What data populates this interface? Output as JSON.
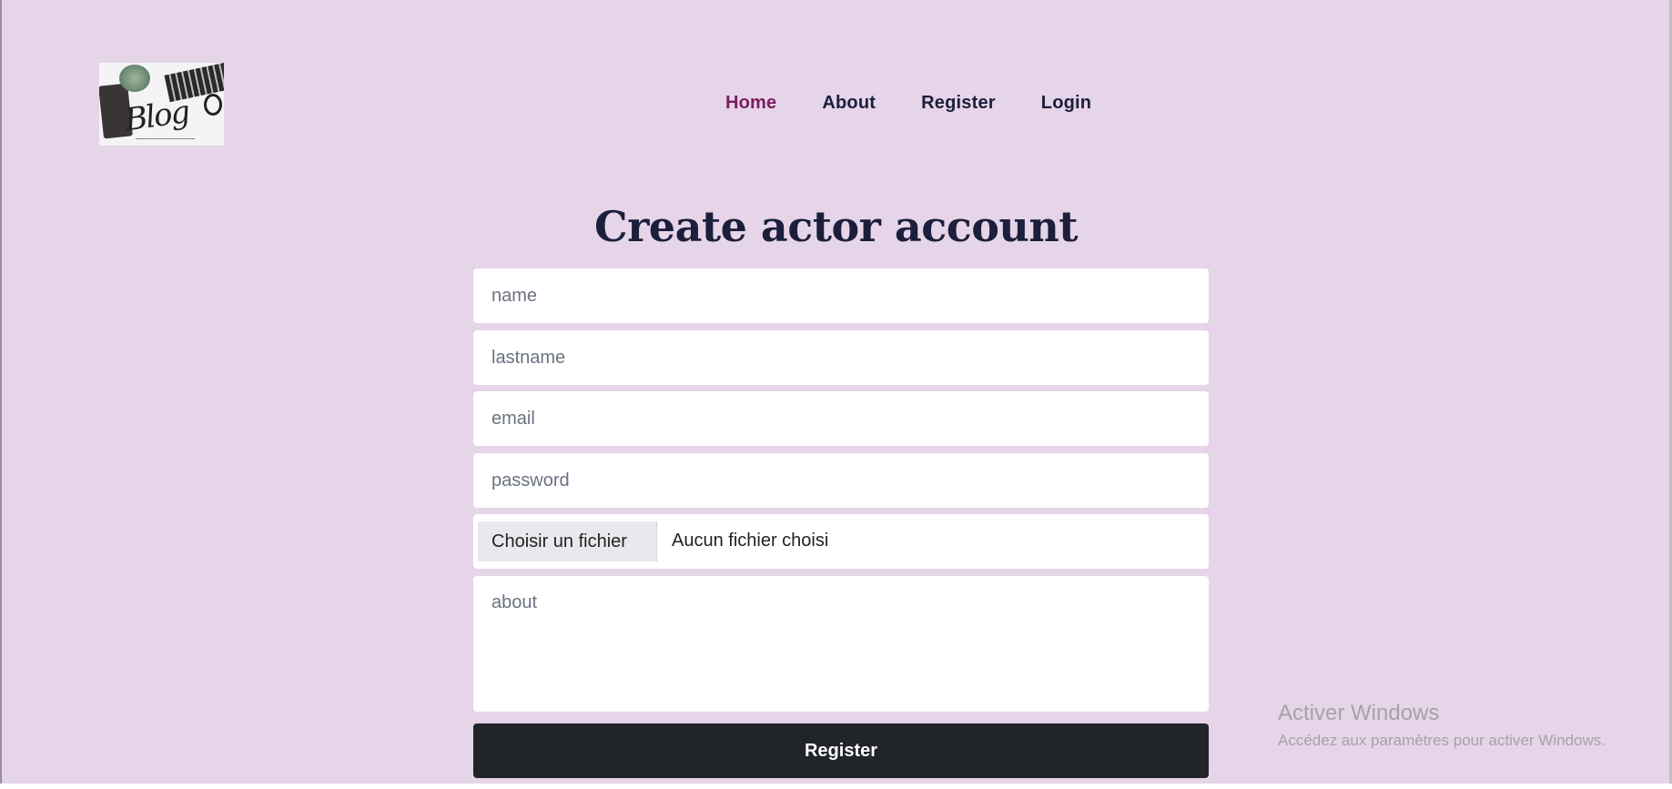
{
  "header": {
    "logo_text": "Blog",
    "nav": [
      {
        "label": "Home",
        "active": true
      },
      {
        "label": "About",
        "active": false
      },
      {
        "label": "Register",
        "active": false
      },
      {
        "label": "Login",
        "active": false
      }
    ]
  },
  "form": {
    "title": "Create actor account",
    "fields": {
      "name_placeholder": "name",
      "lastname_placeholder": "lastname",
      "email_placeholder": "email",
      "password_placeholder": "password",
      "about_placeholder": "about"
    },
    "file": {
      "button_label": "Choisir un fichier",
      "status": "Aucun fichier choisi"
    },
    "submit_label": "Register"
  },
  "watermark": {
    "line1": "Activer Windows",
    "line2": "Accédez aux paramètres pour activer Windows."
  },
  "colors": {
    "background": "#e6d4e8",
    "nav_active": "#7a1e5e",
    "nav_text": "#1b1f3b",
    "button": "#212429"
  }
}
